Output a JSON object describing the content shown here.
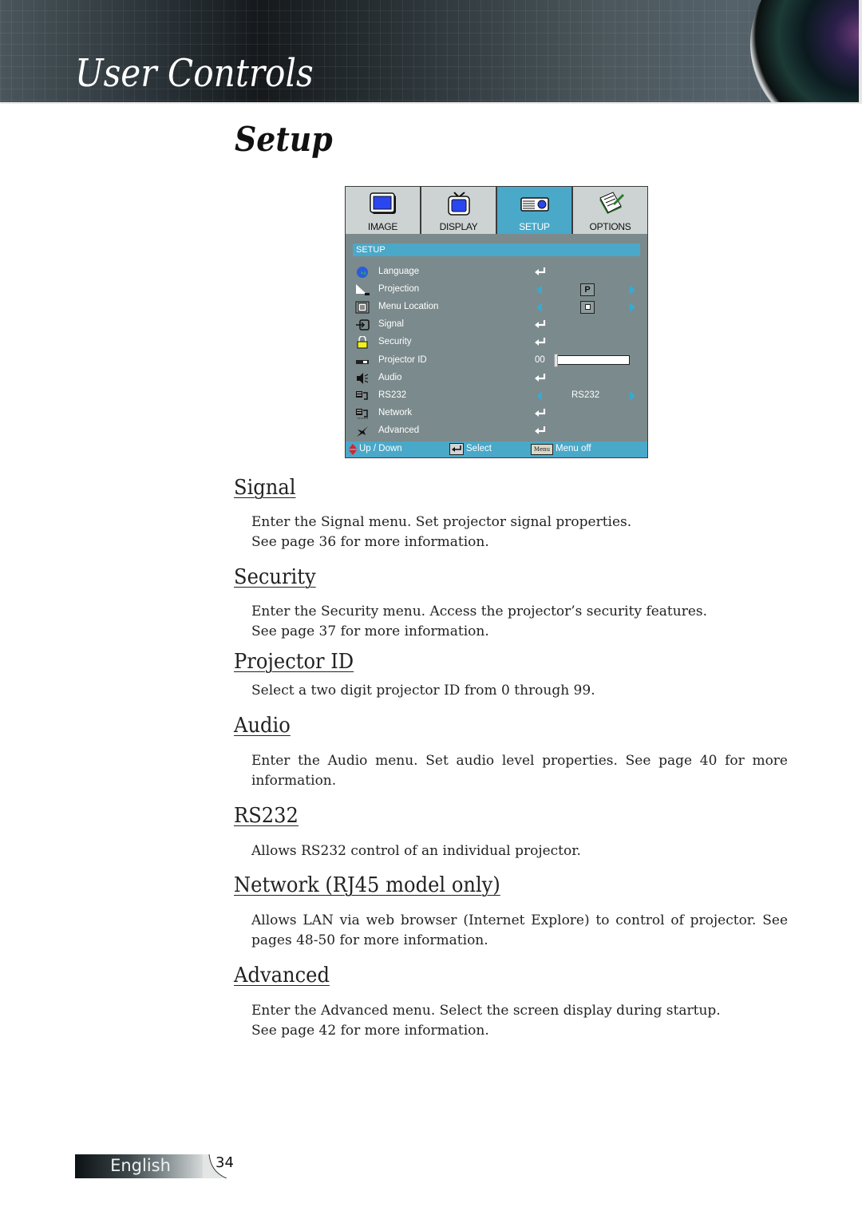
{
  "header": {
    "section_title": "User Controls"
  },
  "page": {
    "heading": "Setup"
  },
  "osd": {
    "tabs": [
      {
        "label": "IMAGE",
        "icon": "monitor-icon",
        "active": false
      },
      {
        "label": "DISPLAY",
        "icon": "tv-icon",
        "active": false
      },
      {
        "label": "SETUP",
        "icon": "projector-icon",
        "active": true
      },
      {
        "label": "OPTIONS",
        "icon": "notepad-pencil-icon",
        "active": false
      }
    ],
    "section_title": "SETUP",
    "rows": [
      {
        "label": "Language",
        "icon": "globe-icon",
        "control": "enter"
      },
      {
        "label": "Projection",
        "icon": "projection-icon",
        "control": "arrows",
        "value": "P"
      },
      {
        "label": "Menu Location",
        "icon": "menu-location-icon",
        "control": "arrows",
        "value": "center"
      },
      {
        "label": "Signal",
        "icon": "signal-input-icon",
        "control": "enter"
      },
      {
        "label": "Security",
        "icon": "lock-icon",
        "control": "enter"
      },
      {
        "label": "Projector ID",
        "icon": "projector-id-icon",
        "control": "slider",
        "value": "00",
        "slider_fraction": 0.0
      },
      {
        "label": "Audio",
        "icon": "speaker-icon",
        "control": "enter"
      },
      {
        "label": "RS232",
        "icon": "rs232-icon",
        "control": "arrows",
        "value": "RS232"
      },
      {
        "label": "Network",
        "icon": "network-icon",
        "control": "enter"
      },
      {
        "label": "Advanced",
        "icon": "advanced-icon",
        "control": "enter"
      }
    ],
    "footer": {
      "updown": "Up / Down",
      "select": "Select",
      "menu_key": "Menu",
      "menu_off": "Menu off"
    },
    "colors": {
      "accent": "#4aa8c8",
      "panel": "#7b8a8c",
      "tab": "#cdd3d3"
    }
  },
  "sections": [
    {
      "title": "Signal",
      "lines": [
        "Enter the Signal menu. Set projector signal properties.",
        "See page 36 for more information."
      ]
    },
    {
      "title": "Security",
      "lines": [
        "Enter the Security menu. Access the projector’s security features.",
        "See page 37 for more information."
      ]
    },
    {
      "title": "Projector ID",
      "lines": [
        "Select a two digit projector ID from 0 through 99."
      ]
    },
    {
      "title": "Audio",
      "lines": [
        "Enter the Audio menu. Set audio level properties. See page 40 for more information."
      ]
    },
    {
      "title": "RS232",
      "lines": [
        "Allows RS232 control of an individual projector."
      ]
    },
    {
      "title": "Network (RJ45 model only)",
      "lines": [
        "Allows LAN via web browser (Internet Explore) to control of projector. See pages 48-50 for more information."
      ]
    },
    {
      "title": "Advanced",
      "lines": [
        "Enter the Advanced menu. Select the screen display during startup.",
        "See page 42 for more information."
      ]
    }
  ],
  "footer": {
    "language": "English",
    "page_number": "34"
  }
}
